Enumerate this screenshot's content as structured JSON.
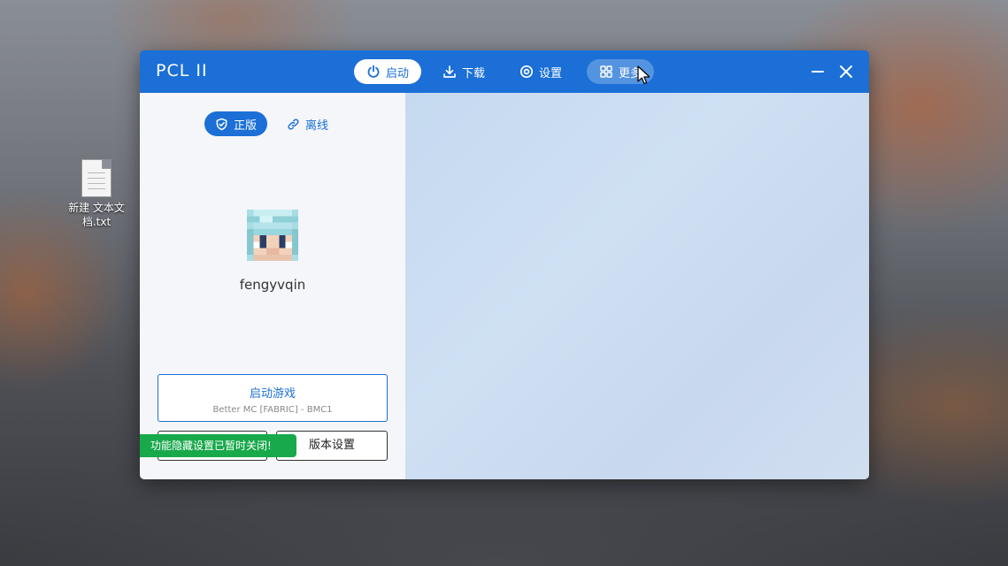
{
  "desktop": {
    "file_label_line1": "新建 文本文",
    "file_label_line2": "档.txt"
  },
  "titlebar": {
    "brand": "PCL II",
    "nav": [
      {
        "label": "启动",
        "icon": "power-icon",
        "active": true
      },
      {
        "label": "下载",
        "icon": "download-icon"
      },
      {
        "label": "设置",
        "icon": "settings-icon"
      },
      {
        "label": "更多",
        "icon": "grid-icon",
        "hover": true
      }
    ],
    "controls": [
      "minimize-icon",
      "close-icon"
    ]
  },
  "account": {
    "modes": [
      {
        "label": "正版",
        "icon": "shield-check-icon",
        "selected": true
      },
      {
        "label": "离线",
        "icon": "link-icon",
        "selected": false
      }
    ],
    "username": "fengyvqin"
  },
  "launch": {
    "title": "启动游戏",
    "subtitle": "Better MC [FABRIC] - BMC1",
    "version_settings": "版本设置"
  },
  "toast": {
    "message": "功能隐藏设置已暂时关闭!"
  },
  "colors": {
    "accent": "#1b6fd6",
    "toast": "#18a94b"
  }
}
